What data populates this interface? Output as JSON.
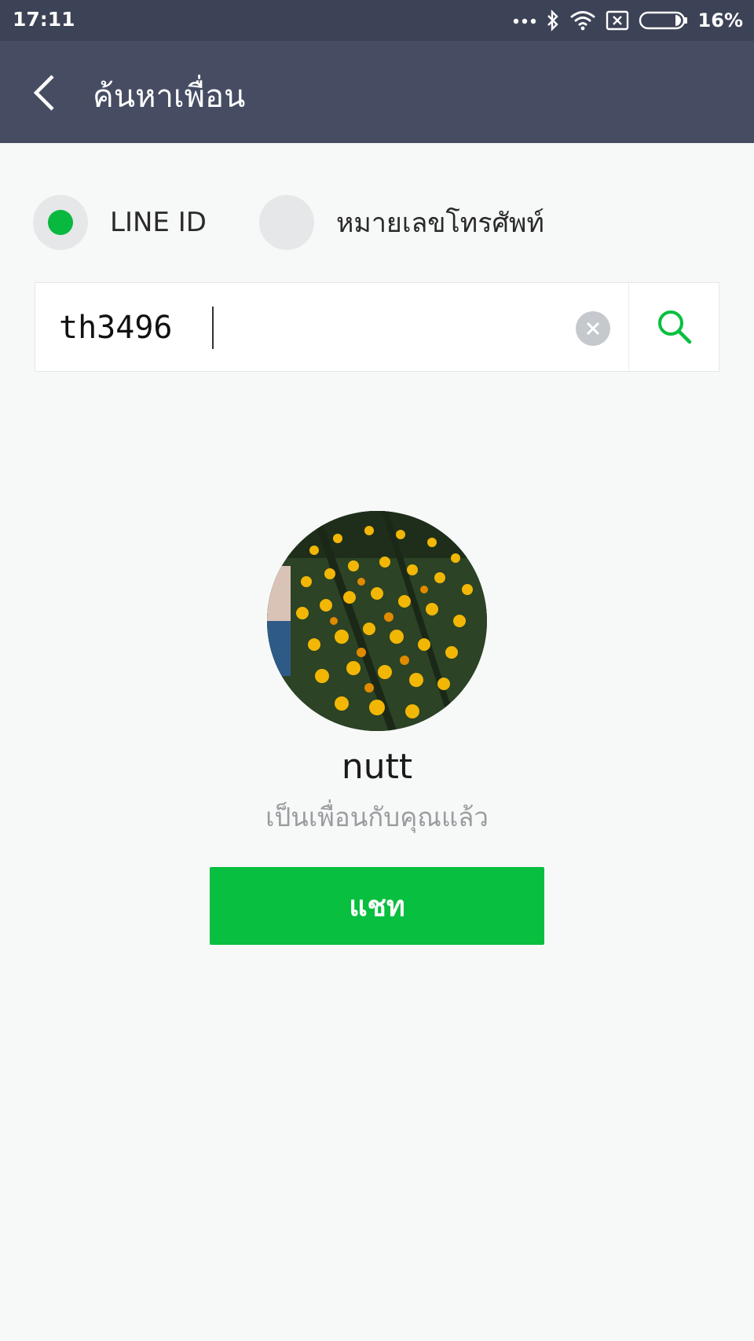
{
  "status_bar": {
    "time": "17:11",
    "battery_percent": "16%",
    "icons": [
      "more-dots-icon",
      "bluetooth-icon",
      "wifi-icon",
      "sim-x-icon",
      "battery-icon"
    ]
  },
  "app_bar": {
    "title": "ค้นหาเพื่อน",
    "back_icon": "chevron-left-icon"
  },
  "search_type": {
    "options": [
      {
        "label": "LINE ID",
        "selected": true
      },
      {
        "label": "หมายเลขโทรศัพท์",
        "selected": false
      }
    ]
  },
  "search": {
    "value": "th3496",
    "clear_icon": "clear-x-icon",
    "search_icon": "search-icon"
  },
  "result": {
    "name": "nutt",
    "status": "เป็นเพื่อนกับคุณแล้ว",
    "action_label": "แชท"
  },
  "colors": {
    "status_bar": "#3d4356",
    "app_bar": "#464d63",
    "accent_green": "#08bf3f",
    "background": "#f7f8f8"
  }
}
